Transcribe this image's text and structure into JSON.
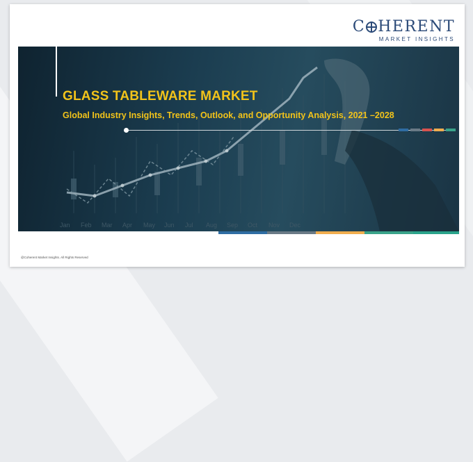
{
  "brand": {
    "logo_line1": "COHERENT",
    "logo_line2": "MARKET INSIGHTS",
    "color": "#2b4a78"
  },
  "banner": {
    "title": "GLASS TABLEWARE MARKET",
    "subtitle": "Global Industry Insights, Trends, Outlook, and Opportunity Analysis, 2021 –2028",
    "title_color": "#f2c31a",
    "background_image": "stock-market chart with hand drawing a rising line",
    "month_labels": [
      "Jan",
      "Feb",
      "Mar",
      "Apr",
      "May",
      "Jun",
      "Jul",
      "Aug",
      "Sep",
      "Oct",
      "Nov",
      "Dec"
    ],
    "swatch_colors": [
      "#2f6da3",
      "#6a7a86",
      "#d9534f",
      "#f0ad4e",
      "#3aa38a"
    ]
  },
  "footer": {
    "copyright": "@Coherent Market Insights. All Rights Reserved",
    "bar_colors": [
      "#2f6da3",
      "#6a7a86",
      "#f0ad4e",
      "#3aa38a",
      "#2aa38b"
    ]
  }
}
